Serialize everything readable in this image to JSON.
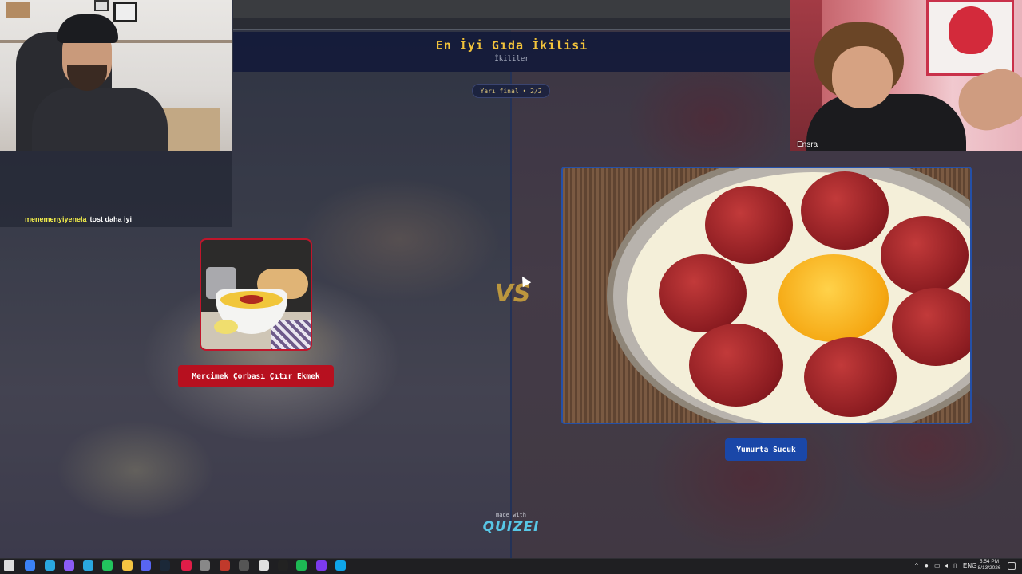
{
  "header": {
    "title": "En İyi Gıda İkilisi",
    "subtitle": "İkililer",
    "round": "Yarı final • 2/2"
  },
  "choices": {
    "left": {
      "label": "Mercimek Çorbası Çıtır Ekmek",
      "accent": "#b7101f"
    },
    "right": {
      "label": "Yumurta Sucuk",
      "accent": "#1a47a8"
    }
  },
  "vs": "VS",
  "footer": {
    "made_with": "made with",
    "brand": "QUIZEI"
  },
  "stream": {
    "chat": {
      "user": "menemenyiyenela",
      "message": "tost daha iyi"
    },
    "guest_cam_name": "Ensra"
  },
  "taskbar": {
    "icons": [
      "start-icon",
      "search-icon",
      "edge-icon",
      "obs-icon",
      "telegram-icon",
      "whatsapp-icon",
      "file-explorer-icon",
      "discord-icon",
      "steam-icon",
      "pdf-icon",
      "app-icon",
      "app-icon-2",
      "settings-icon",
      "chrome-icon",
      "capcut-icon",
      "spotify-icon",
      "app-icon-3",
      "edge-active-icon"
    ],
    "tray_lang": "ENG",
    "time": "5:54 PM",
    "date": "8/13/2026"
  },
  "colors": {
    "title_gold": "#f2c33b",
    "brand_cyan": "#58c7e6"
  }
}
